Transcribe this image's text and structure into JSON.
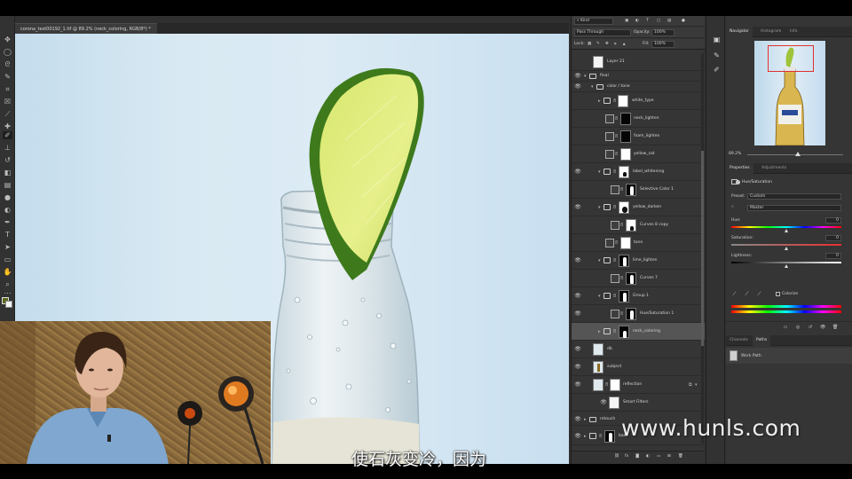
{
  "document": {
    "tab_title": "corona_test00192_1.tif @ 89.2% (neck_coloring, RGB/8*) *"
  },
  "layers_panel": {
    "kind_filter": "Kind",
    "blend_mode": "Pass Through",
    "opacity_label": "Opacity:",
    "opacity_value": "100%",
    "lock_label": "Lock:",
    "fill_label": "Fill:",
    "fill_value": "100%",
    "layers": [
      {
        "name": "Layer 21"
      },
      {
        "name": "final"
      },
      {
        "name": "color / tone"
      },
      {
        "name": "white_type"
      },
      {
        "name": "neck_lighten"
      },
      {
        "name": "foam_lighten"
      },
      {
        "name": "yellow_sat"
      },
      {
        "name": "label_whitening"
      },
      {
        "name": "Selective Color 1"
      },
      {
        "name": "yellow_darken"
      },
      {
        "name": "Curves 8 copy"
      },
      {
        "name": "tone"
      },
      {
        "name": "lime_lighten"
      },
      {
        "name": "Curves 7"
      },
      {
        "name": "Group 1"
      },
      {
        "name": "Hue/Saturation 1"
      },
      {
        "name": "neck_coloring"
      },
      {
        "name": "db"
      },
      {
        "name": "subject"
      },
      {
        "name": "reflection"
      },
      {
        "name": "Smart Filters"
      },
      {
        "name": "retouch"
      },
      {
        "name": "base"
      }
    ]
  },
  "navigator": {
    "tabs": [
      "Navigator",
      "Histogram",
      "Info"
    ],
    "zoom": "89.2%"
  },
  "properties": {
    "tabs": [
      "Properties",
      "Adjustments"
    ],
    "title": "Hue/Saturation",
    "preset_label": "Preset:",
    "preset_value": "Custom",
    "channel_value": "Master",
    "hue_label": "Hue:",
    "hue_value": "0",
    "saturation_label": "Saturation:",
    "saturation_value": "0",
    "lightness_label": "Lightness:",
    "lightness_value": "0",
    "colorize_label": "Colorize"
  },
  "paths_panel": {
    "tabs": [
      "Channels",
      "Paths"
    ],
    "items": [
      "Work Path"
    ]
  },
  "overlays": {
    "watermark": "www.hunls.com",
    "subtitle": "使石灰变冷，因为"
  }
}
